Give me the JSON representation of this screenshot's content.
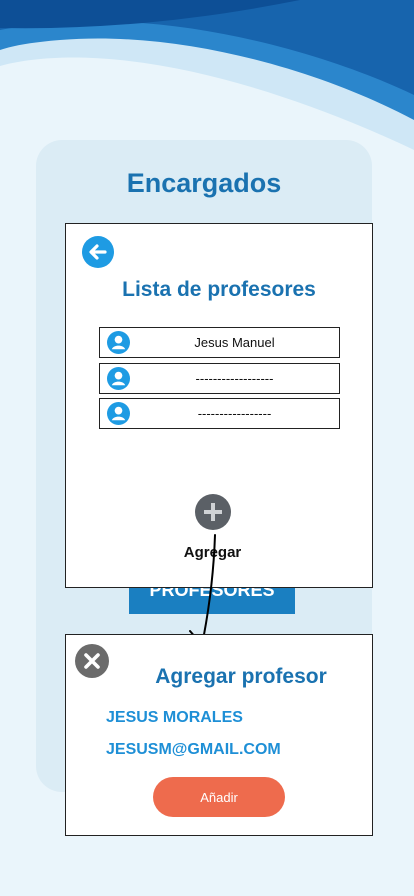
{
  "page_title": "Encargados",
  "behind_button_label": "PROFESORES",
  "teacher_list": {
    "title": "Lista de profesores",
    "back_icon": "back-arrow-icon",
    "items": [
      {
        "name": "Jesus Manuel"
      },
      {
        "name": "------------------"
      },
      {
        "name": "-----------------"
      }
    ],
    "add_label": "Agregar",
    "add_icon": "plus-icon"
  },
  "add_teacher_dialog": {
    "title": "Agregar profesor",
    "close_icon": "close-icon",
    "name_value": "JESUS MORALES",
    "email_value": "JESUSM@GMAIL.COM",
    "submit_label": "Añadir"
  },
  "colors": {
    "title_blue": "#1a72b0",
    "accent_blue": "#1e9be3",
    "submit_orange": "#ee6b4d"
  }
}
